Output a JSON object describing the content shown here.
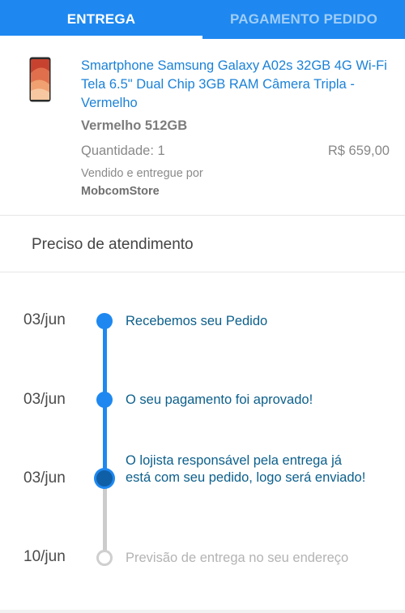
{
  "tabs": [
    {
      "label": "ENTREGA",
      "active": true
    },
    {
      "label": "PAGAMENTO PEDIDO",
      "active": false
    }
  ],
  "product": {
    "image_icon": "smartphone-red-icon",
    "title": "Smartphone Samsung Galaxy A02s 32GB 4G Wi-Fi Tela 6.5\" Dual Chip 3GB RAM Câmera Tripla - Vermelho",
    "variant": "Vermelho 512GB",
    "quantity": "Quantidade: 1",
    "price": "R$ 659,00",
    "seller_prefix": "Vendido e entregue por",
    "seller_name": "MobcomStore"
  },
  "section": {
    "title": "Preciso de atendimento"
  },
  "timeline": [
    {
      "date": "03/jun",
      "text": "Recebemos seu Pedido",
      "status": "done"
    },
    {
      "date": "03/jun",
      "text": "O seu pagamento foi aprovado!",
      "status": "done"
    },
    {
      "date": "03/jun",
      "text": "O lojista responsável pela entrega já está com seu pedido, logo será enviado!",
      "status": "current"
    },
    {
      "date": "10/jun",
      "text": "Previsão de entrega no seu endereço",
      "status": "pending"
    }
  ],
  "colors": {
    "brand": "#1e88f0",
    "link": "#1b82d8",
    "step_text": "#0c5f8b",
    "pending": "#cccccc"
  }
}
